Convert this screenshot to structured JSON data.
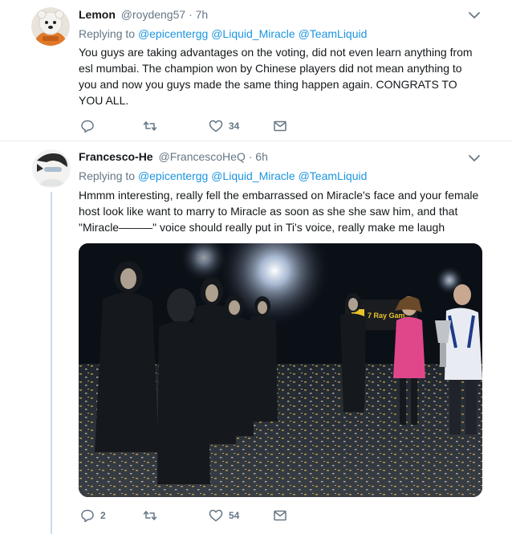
{
  "tweets": [
    {
      "name": "Lemon",
      "handle": "@roydeng57",
      "separator": "·",
      "time": "7h",
      "replying_prefix": "Replying to",
      "mentions": [
        "@epicentergg",
        "@Liquid_Miracle",
        "@TeamLiquid"
      ],
      "text": "You guys are taking advantages on the voting, did not even learn anything from esl mumbai. The champion won by Chinese players did not mean anything to you and now you guys made the same thing happen again. CONGRATS TO YOU ALL.",
      "reply_count": "",
      "retweet_count": "",
      "like_count": "34",
      "icons": [
        "reply-icon",
        "retweet-icon",
        "heart-icon",
        "envelope-icon",
        "chevron-down-icon"
      ]
    },
    {
      "name": "Francesco-He",
      "handle": "@FrancescoHeQ",
      "separator": "·",
      "time": "6h",
      "replying_prefix": "Replying to",
      "mentions": [
        "@epicentergg",
        "@Liquid_Miracle",
        "@TeamLiquid"
      ],
      "text": "Hmmm interesting, really fell the embarrassed on Miracle's face and your female host look like want to marry to Miracle as soon as she she saw him, and that \"Miracle———\" voice should really put in Ti's voice, really make me laugh",
      "media_banner": "7 Ray Gam...",
      "reply_count": "2",
      "retweet_count": "",
      "like_count": "54",
      "icons": [
        "reply-icon",
        "retweet-icon",
        "heart-icon",
        "envelope-icon",
        "chevron-down-icon"
      ]
    }
  ],
  "colors": {
    "text": "#14171a",
    "secondary": "#657786",
    "link": "#1b95e0",
    "thread_line": "#c4dbee",
    "divider": "#e6ecf0"
  }
}
